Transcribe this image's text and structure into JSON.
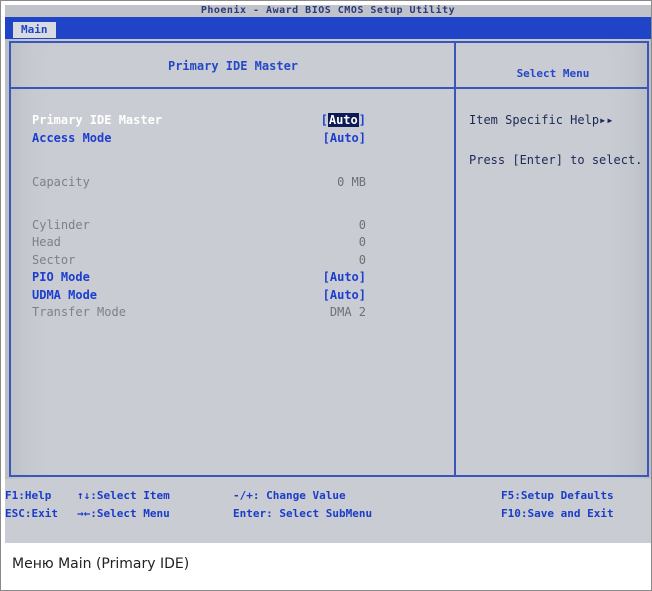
{
  "bios": {
    "title": "Phoenix - Award BIOS CMOS Setup Utility",
    "menu_tab": "Main",
    "left_header": "Primary IDE Master",
    "right_header": "Select Menu",
    "rows": [
      {
        "label": "Primary IDE Master",
        "value": "Auto",
        "value_brackets": true,
        "style": "active",
        "selected": true
      },
      {
        "label": "Access Mode",
        "value": "[Auto]",
        "style": "blue"
      },
      {
        "label": "Capacity",
        "value": "0 MB",
        "style": "gray"
      },
      {
        "label": "Cylinder",
        "value": "0",
        "style": "gray"
      },
      {
        "label": "Head",
        "value": "0",
        "style": "gray"
      },
      {
        "label": "Sector",
        "value": "0",
        "style": "gray"
      },
      {
        "label": "PIO Mode",
        "value": "[Auto]",
        "style": "blue"
      },
      {
        "label": "UDMA Mode",
        "value": "[Auto]",
        "style": "blue"
      },
      {
        "label": "Transfer Mode",
        "value": "DMA 2",
        "style": "gray"
      }
    ],
    "help": {
      "item_specific": "Item Specific Help▸▸",
      "press_enter": "Press [Enter] to select."
    },
    "footer": {
      "f1": "F1:Help",
      "select_item": "↑↓:Select Item",
      "change_value": "-/+: Change Value",
      "f5": "F5:Setup Defaults",
      "esc": "ESC:Exit",
      "select_menu": "→←:Select Menu",
      "enter": "Enter: Select SubMenu",
      "f10": "F10:Save and Exit"
    }
  },
  "caption": "Меню Main (Primary IDE)"
}
